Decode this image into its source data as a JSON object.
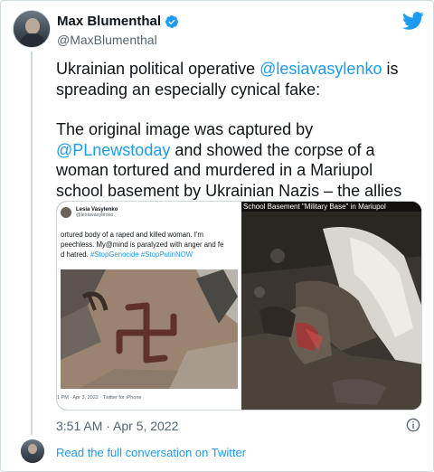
{
  "author": {
    "name": "Max Blumenthal",
    "handle": "@MaxBlumenthal"
  },
  "tweet": {
    "para1_pre": "Ukrainian political operative ",
    "para1_mention": "@lesiavasylenko",
    "para1_post": " is spreading an especially cynical fake:",
    "para2_pre": "The original image was captured by ",
    "para2_mention": "@PLnewstoday",
    "para2_post": " and showed the corpse of a woman tortured and murdered in a Mariupol school basement by Ukrainian Nazis – the allies of Vasylenko."
  },
  "media": {
    "left": {
      "name": "Lesia Vasylenko",
      "handle": "@lesiavasylenko",
      "line1": "ortured body of a raped and killed woman. I'm",
      "line2": "peechless. My@mind is paralyzed with anger and fe",
      "line3_pre": "d hatred. ",
      "line3_tags": "#StopGenocide #StopPutinNOW",
      "footer": "1 PM · Apr 3, 2022 · Twitter for iPhone"
    },
    "right": {
      "caption": "School Basement \"Military Base\" in Mariupol"
    }
  },
  "timestamp": "3:51 AM · Apr 5, 2022",
  "footer": {
    "link": "Read the full conversation on Twitter"
  },
  "colors": {
    "accent": "#1d9bf0",
    "text": "#0f1419",
    "secondary": "#536471"
  }
}
